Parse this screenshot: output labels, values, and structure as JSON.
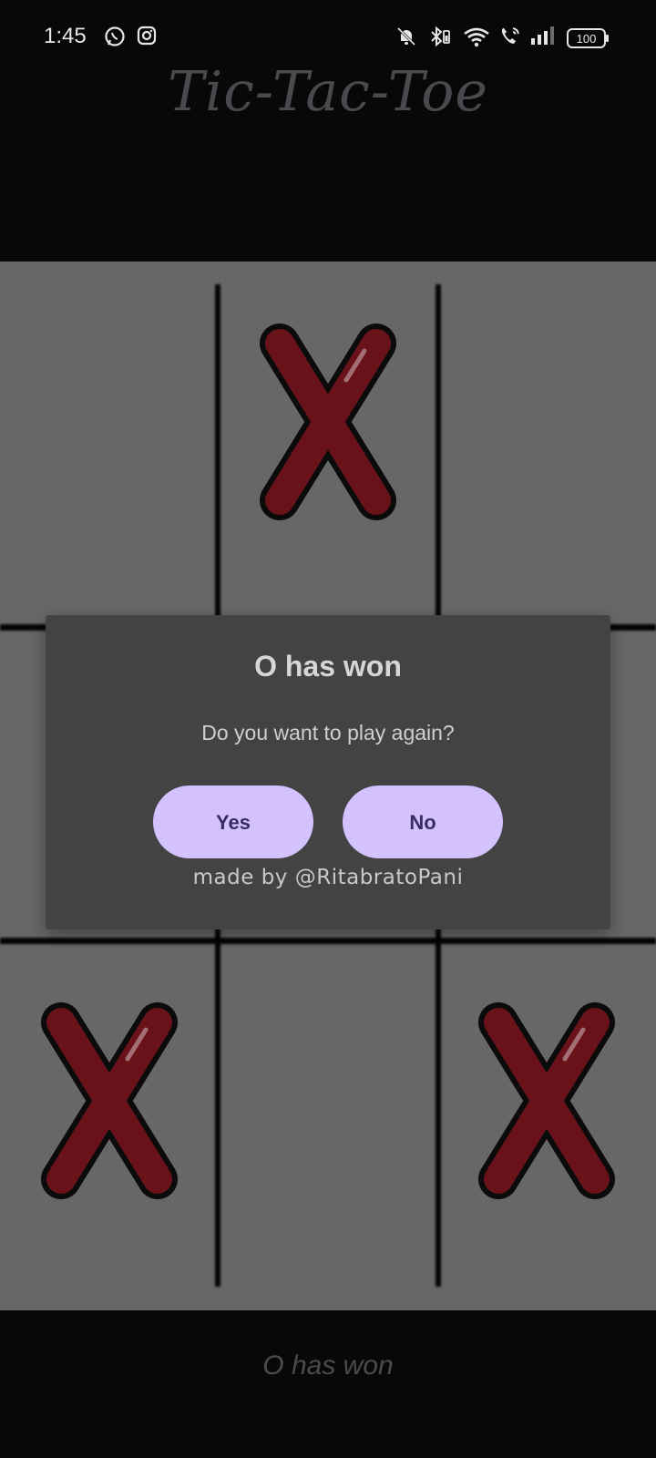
{
  "status_bar": {
    "time": "1:45",
    "battery": "100",
    "left_icons": [
      "whatsapp-icon",
      "instagram-icon"
    ],
    "right_icons": [
      "notifications-muted-icon",
      "bluetooth-icon",
      "wifi-icon",
      "wifi-calling-icon",
      "signal-icon",
      "battery-icon"
    ]
  },
  "app": {
    "title": "Tic-Tac-Toe",
    "status_text": "O has won"
  },
  "board": {
    "cells": [
      "",
      "X",
      "",
      "",
      "",
      "",
      "X",
      "",
      "X"
    ],
    "mark_color": "#6a1219",
    "background_color": "#676767"
  },
  "dialog": {
    "title": "O has won",
    "message": "Do you want to play again?",
    "yes_label": "Yes",
    "no_label": "No",
    "credit": "made by @RitabratoPani",
    "button_color": "#d4c2ff"
  }
}
